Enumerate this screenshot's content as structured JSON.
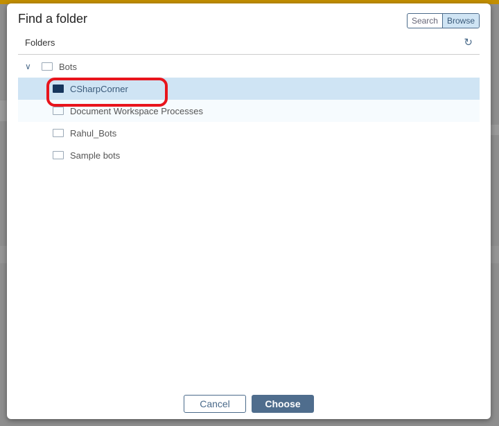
{
  "dialog": {
    "title": "Find a folder",
    "mode_search": "Search",
    "mode_browse": "Browse",
    "folders_label": "Folders",
    "tree": {
      "root": "Bots",
      "children": [
        "CSharpCorner",
        "Document Workspace Processes",
        "Rahul_Bots",
        "Sample bots"
      ],
      "selected": "CSharpCorner"
    },
    "cancel": "Cancel",
    "choose": "Choose"
  },
  "colors": {
    "accent": "#4f6d8d",
    "selection": "#cfe4f4",
    "highlight_ring": "#e8141c"
  }
}
